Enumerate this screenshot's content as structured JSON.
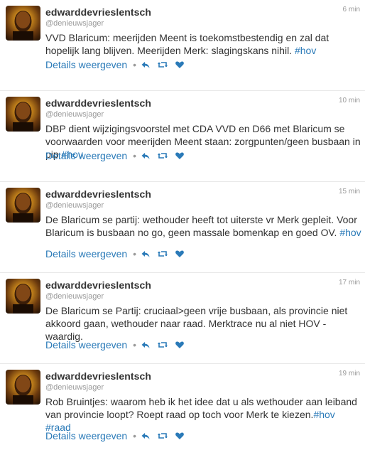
{
  "tweets": [
    {
      "username": "edwarddevrieslentsch",
      "handle": "@denieuwsjager",
      "time": "6 min",
      "text": "VVD Blaricum: meerijden Meent is toekomstbestendig en zal dat hopelijk lang blijven. Meerijden Merk: slagingskans nihil. ",
      "tags": [
        "#hov"
      ],
      "details_label": "Details weergeven"
    },
    {
      "username": "edwarddevrieslentsch",
      "handle": "@denieuwsjager",
      "time": "10 min",
      "text": "DBP dient wijzigingsvoorstel met CDA VVD en D66 met Blaricum se voorwaarden voor meerijden Meent staan: zorgpunten/geen busbaan in pip ",
      "tags": [
        "#hov"
      ],
      "details_label": "Details weergeven"
    },
    {
      "username": "edwarddevrieslentsch",
      "handle": "@denieuwsjager",
      "time": "15 min",
      "text": "De Blaricum se partij: wethouder heeft tot uiterste vr Merk gepleit. Voor Blaricum is busbaan no go, geen massale bomenkap en goed OV. ",
      "tags": [
        "#hov"
      ],
      "details_label": "Details weergeven"
    },
    {
      "username": "edwarddevrieslentsch",
      "handle": "@denieuwsjager",
      "time": "17 min",
      "text": "De Blaricum se Partij: cruciaal>geen vrije busbaan, als provincie niet akkoord gaan, wethouder naar raad. Merktrace nu al niet HOV - waardig.",
      "tags": [],
      "details_label": "Details weergeven"
    },
    {
      "username": "edwarddevrieslentsch",
      "handle": "@denieuwsjager",
      "time": "19 min",
      "text": "Rob Bruintjes: waarom heb ik het idee dat u als wethouder aan leiband van provincie loopt? Roept raad op toch voor Merk te kiezen.",
      "tags": [
        "#hov",
        "#raad"
      ],
      "details_label": "Details weergeven"
    }
  ],
  "icons": {
    "reply": "reply-icon",
    "retweet": "retweet-icon",
    "favorite": "heart-icon"
  },
  "colors": {
    "link": "#2a7ab8",
    "text": "#333333",
    "muted": "#999999",
    "divider": "#e8e8e8"
  }
}
